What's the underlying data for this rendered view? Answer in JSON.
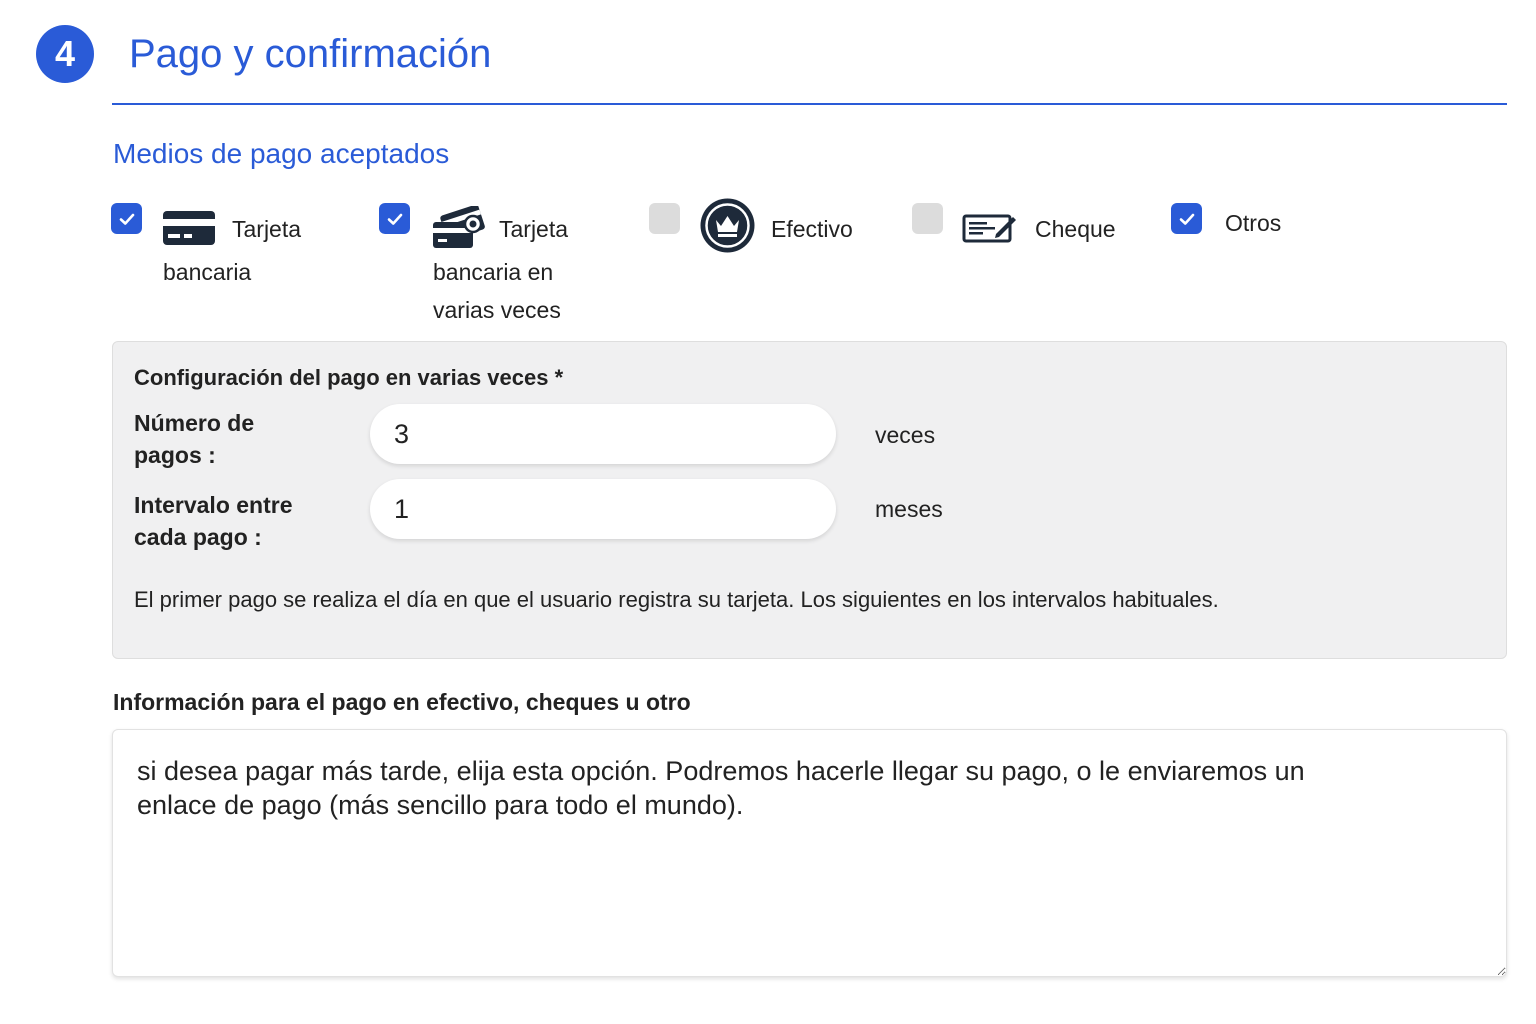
{
  "step": {
    "number": "4",
    "title": "Pago y confirmación"
  },
  "payment_methods": {
    "title": "Medios de pago aceptados",
    "items": [
      {
        "label_line1": "Tarjeta",
        "label_line2": "bancaria",
        "label_line3": "",
        "checked": true,
        "icon": "credit-card-icon"
      },
      {
        "label_line1": "Tarjeta",
        "label_line2": "bancaria en",
        "label_line3": "varias veces",
        "checked": true,
        "icon": "multiple-cards-icon"
      },
      {
        "label_line1": "Efectivo",
        "label_line2": "",
        "label_line3": "",
        "checked": false,
        "icon": "cash-coin-icon"
      },
      {
        "label_line1": "Cheque",
        "label_line2": "",
        "label_line3": "",
        "checked": false,
        "icon": "cheque-icon"
      },
      {
        "label_line1": "Otros",
        "label_line2": "",
        "label_line3": "",
        "checked": true,
        "icon": ""
      }
    ]
  },
  "installments": {
    "title": "Configuración del pago en varias veces *",
    "count_label_line1": "Número de",
    "count_label_line2": "pagos :",
    "count_value": "3",
    "count_unit": "veces",
    "interval_label_line1": "Intervalo entre",
    "interval_label_line2": "cada pago :",
    "interval_value": "1",
    "interval_unit": "meses",
    "note": "El primer pago se realiza el día en que el usuario registra su tarjeta. Los siguientes en los intervalos habituales."
  },
  "info": {
    "label": "Información para el pago en efectivo, cheques u otro",
    "value": "si desea pagar más tarde, elija esta opción. Podremos hacerle llegar su pago, o le enviaremos un enlace de pago (más sencillo para todo el mundo)."
  },
  "colors": {
    "accent": "#2a5bd7",
    "checkbox_off": "#dcdcdc",
    "panel_bg": "#f0f0f1"
  }
}
